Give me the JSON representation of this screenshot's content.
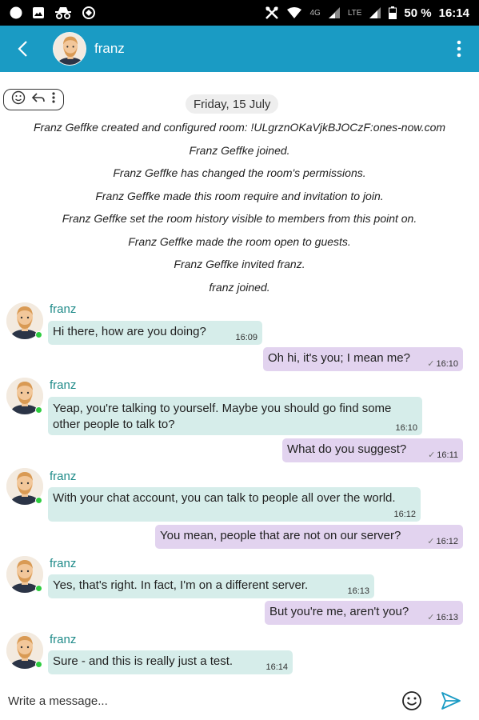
{
  "status_bar": {
    "network": "4G",
    "lte": "LTE",
    "battery": "50 %",
    "time": "16:14",
    "icons": [
      "circle-icon",
      "image-icon",
      "incognito-icon",
      "sync-icon",
      "tools-icon",
      "wifi-icon",
      "signal-icon",
      "battery-icon"
    ]
  },
  "header": {
    "title": "franz",
    "accent": "#1a9bc4"
  },
  "date_divider": "Friday, 15 July",
  "events": [
    "Franz Geffke created and configured room: !ULgrznOKaVjkBJOCzF:ones-now.com",
    "Franz Geffke joined.",
    "Franz Geffke has changed the room's permissions.",
    "Franz Geffke made this room require and invitation to join.",
    "Franz Geffke set the room history visible to members from this point on.",
    "Franz Geffke made the room open to guests.",
    "Franz Geffke invited franz.",
    "franz joined."
  ],
  "messages": [
    {
      "sender": "franz",
      "text": "Hi there, how are you doing?",
      "time": "16:09"
    },
    {
      "text": "Oh hi, it's you; I mean me?",
      "time": "16:10"
    },
    {
      "sender": "franz",
      "text": "Yeap, you're talking to yourself. Maybe you should go find some other people to talk to?",
      "time": "16:10"
    },
    {
      "text": "What do you suggest?",
      "time": "16:11"
    },
    {
      "sender": "franz",
      "text": "With your chat account, you can talk to people all over the world.",
      "time": "16:12"
    },
    {
      "text": "You mean, people that are not on our server?",
      "time": "16:12"
    },
    {
      "sender": "franz",
      "text": "Yes, that's right. In fact, I'm on a different server.",
      "time": "16:13"
    },
    {
      "text": "But you're me, aren't you?",
      "time": "16:13"
    },
    {
      "sender": "franz",
      "text": "Sure - and this is really just a test.",
      "time": "16:14"
    }
  ],
  "composer": {
    "placeholder": "Write a message..."
  },
  "colors": {
    "incoming_bubble": "#d6edea",
    "outgoing_bubble": "#e2d3ef",
    "sender_name": "#1e8a88",
    "online_dot": "#2ecc40",
    "send_icon": "#1a9bc4"
  }
}
